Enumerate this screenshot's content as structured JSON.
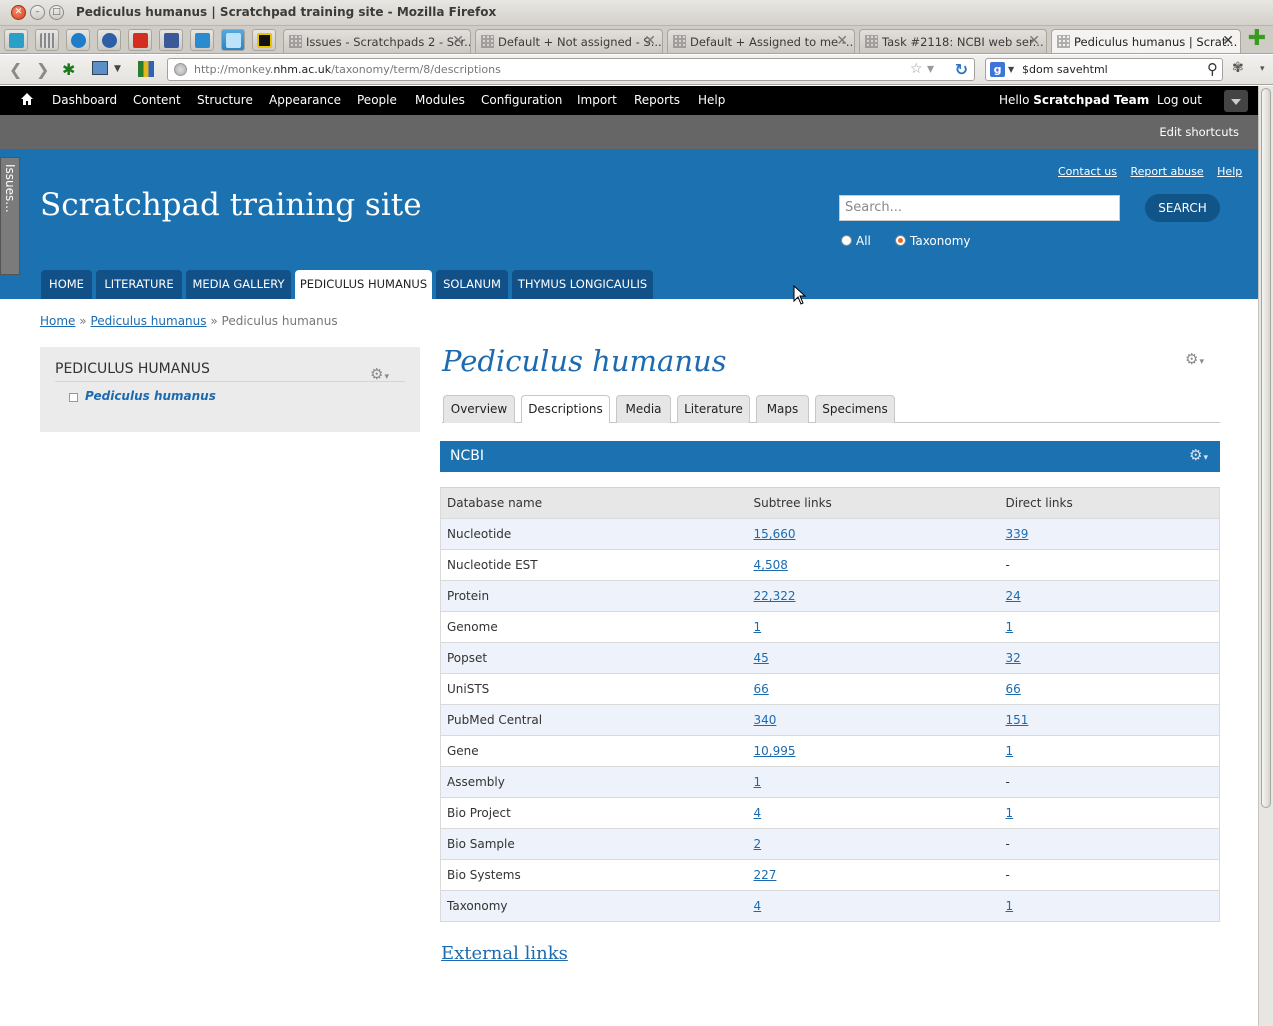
{
  "window": {
    "title": "Pediculus humanus | Scratchpad training site - Mozilla Firefox"
  },
  "browser_tabs": [
    {
      "label": "Issues - Scratchpads 2 - Scr..."
    },
    {
      "label": "Default + Not assigned - S..."
    },
    {
      "label": "Default + Assigned to me -..."
    },
    {
      "label": "Task #2118: NCBI web ser..."
    },
    {
      "label": "Pediculus humanus | Scrat..."
    }
  ],
  "urlbar": {
    "prefix": "http://monkey.",
    "domain": "nhm.ac.uk",
    "path": "/taxonomy/term/8/descriptions"
  },
  "searchbar": {
    "value": "$dom savehtml"
  },
  "admin": {
    "menu": [
      "Dashboard",
      "Content",
      "Structure",
      "Appearance",
      "People",
      "Modules",
      "Configuration",
      "Import",
      "Reports",
      "Help"
    ],
    "hello": "Hello",
    "user": "Scratchpad Team",
    "logout": "Log out",
    "edit_shortcuts": "Edit shortcuts"
  },
  "header": {
    "site_name": "Scratchpad training site",
    "links": [
      "Contact us",
      "Report abuse",
      "Help"
    ],
    "search_placeholder": "Search...",
    "search_button": "SEARCH",
    "radio_all": "All",
    "radio_taxonomy": "Taxonomy",
    "issues_tab": "Issues..."
  },
  "nav": [
    "HOME",
    "LITERATURE",
    "MEDIA GALLERY",
    "PEDICULUS HUMANUS",
    "SOLANUM",
    "THYMUS LONGICAULIS"
  ],
  "breadcrumb": {
    "home": "Home",
    "parent": "Pediculus humanus",
    "sep": "»",
    "current": "Pediculus humanus"
  },
  "sidebar": {
    "title": "PEDICULUS HUMANUS",
    "item": "Pediculus humanus"
  },
  "main": {
    "title": "Pediculus humanus",
    "tabs": [
      "Overview",
      "Descriptions",
      "Media",
      "Literature",
      "Maps",
      "Specimens"
    ],
    "block_title": "NCBI",
    "columns": [
      "Database name",
      "Subtree links",
      "Direct links"
    ],
    "rows": [
      {
        "name": "Nucleotide",
        "subtree": "15,660",
        "direct": "339"
      },
      {
        "name": "Nucleotide EST",
        "subtree": "4,508",
        "direct": "-"
      },
      {
        "name": "Protein",
        "subtree": "22,322",
        "direct": "24"
      },
      {
        "name": "Genome",
        "subtree": "1",
        "direct": "1"
      },
      {
        "name": "Popset",
        "subtree": "45",
        "direct": "32"
      },
      {
        "name": "UniSTS",
        "subtree": "66",
        "direct": "66"
      },
      {
        "name": "PubMed Central",
        "subtree": "340",
        "direct": "151"
      },
      {
        "name": "Gene",
        "subtree": "10,995",
        "direct": "1"
      },
      {
        "name": "Assembly",
        "subtree": "1",
        "direct": "-"
      },
      {
        "name": "Bio Project",
        "subtree": "4",
        "direct": "1"
      },
      {
        "name": "Bio Sample",
        "subtree": "2",
        "direct": "-"
      },
      {
        "name": "Bio Systems",
        "subtree": "227",
        "direct": "-"
      },
      {
        "name": "Taxonomy",
        "subtree": "4",
        "direct": "1"
      }
    ],
    "external_links": "External links"
  },
  "colors": {
    "brand_blue": "#1c71b0",
    "nav_dark": "#125188",
    "link": "#1c6bb0"
  }
}
